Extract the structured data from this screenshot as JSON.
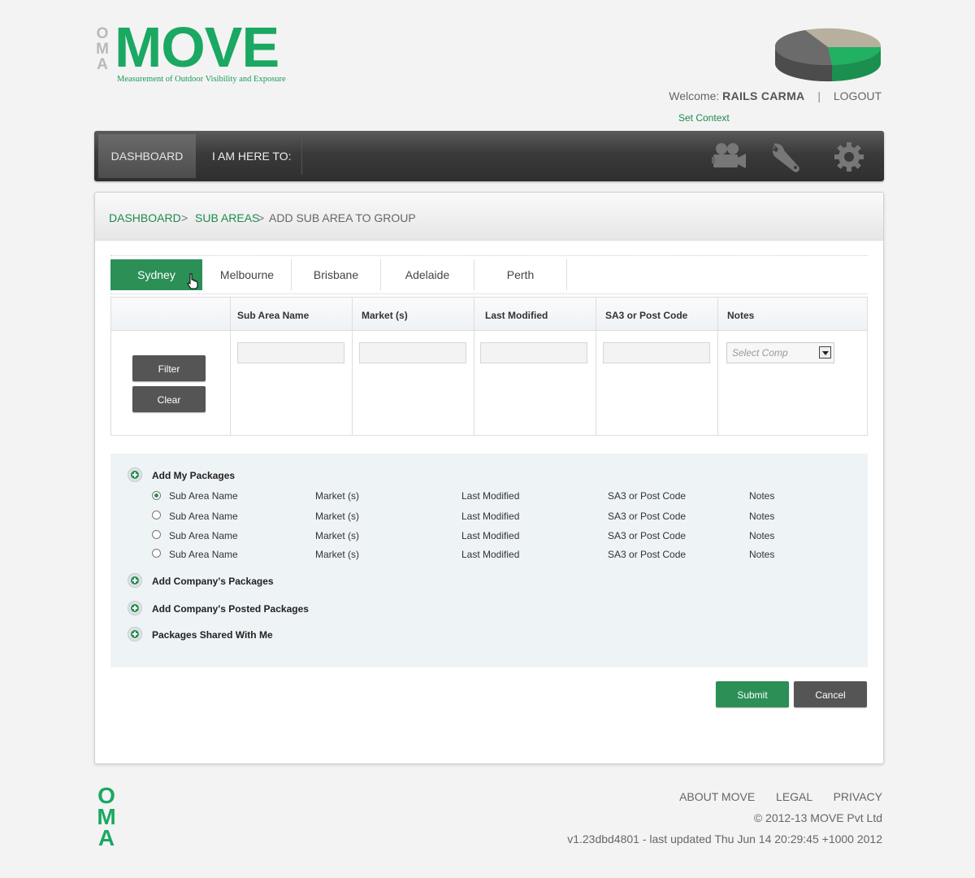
{
  "brand": {
    "oma": [
      "O",
      "M",
      "A"
    ],
    "name": "MOVE",
    "tagline": "Measurement of Outdoor Visibility and Exposure"
  },
  "user": {
    "welcome_label": "Welcome:",
    "name": "RAILS CARMA",
    "separator": "|",
    "logout": "LOGOUT",
    "set_context": "Set Context"
  },
  "nav": {
    "dashboard": "DASHBOARD",
    "here_to": "I AM HERE TO:",
    "icons": [
      "camera-icon",
      "wrench-icon",
      "gear-icon"
    ]
  },
  "breadcrumb": {
    "items": [
      "DASHBOARD",
      "SUB AREAS",
      "ADD SUB AREA TO GROUP"
    ],
    "separator": ">"
  },
  "tabs": [
    {
      "label": "Sydney",
      "active": true
    },
    {
      "label": "Melbourne",
      "active": false
    },
    {
      "label": "Brisbane",
      "active": false
    },
    {
      "label": "Adelaide",
      "active": false
    },
    {
      "label": "Perth",
      "active": false
    }
  ],
  "filter": {
    "columns": [
      "Sub Area Name",
      "Market (s)",
      "Last Modified",
      "SA3 or Post Code",
      "Notes"
    ],
    "select_placeholder": "Select Comp",
    "filter_button": "Filter",
    "clear_button": "Clear"
  },
  "packages": {
    "sections": [
      "Add My Packages",
      "Add Company's Packages",
      "Add Company's Posted Packages",
      "Packages Shared With Me"
    ],
    "rows": [
      {
        "selected": true,
        "cells": [
          "Sub Area Name",
          "Market (s)",
          "Last Modified",
          "SA3 or Post Code",
          "Notes"
        ]
      },
      {
        "selected": false,
        "cells": [
          "Sub Area Name",
          "Market (s)",
          "Last Modified",
          "SA3 or Post Code",
          "Notes"
        ]
      },
      {
        "selected": false,
        "cells": [
          "Sub Area Name",
          "Market (s)",
          "Last Modified",
          "SA3 or Post Code",
          "Notes"
        ]
      },
      {
        "selected": false,
        "cells": [
          "Sub Area Name",
          "Market (s)",
          "Last Modified",
          "SA3 or Post Code",
          "Notes"
        ]
      }
    ]
  },
  "actions": {
    "submit": "Submit",
    "cancel": "Cancel"
  },
  "footer": {
    "links": [
      "ABOUT MOVE",
      "LEGAL",
      "PRIVACY"
    ],
    "copyright": "© 2012-13 MOVE Pvt Ltd",
    "version": "v1.23dbd4801 - last updated Thu Jun 14 20:29:45 +1000 2012"
  },
  "colors": {
    "accent": "#2b8f56",
    "brand": "#1aa862",
    "nav": "#3a3a3a",
    "button_dark": "#555555"
  }
}
